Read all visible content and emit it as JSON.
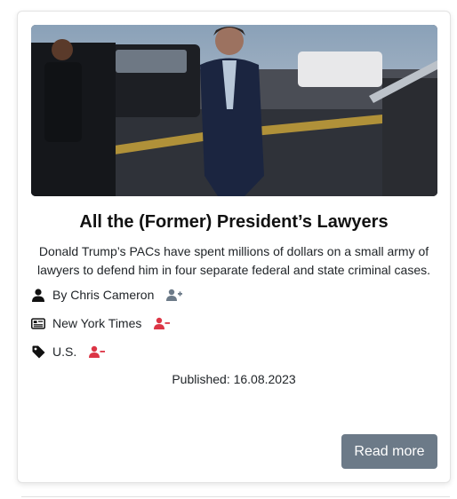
{
  "article": {
    "title": "All the (Former) President’s Lawyers",
    "description": "Donald Trump’s PACs have spent millions of dollars on a small army of lawyers to defend him in four separate federal and state criminal cases.",
    "author": "By Chris Cameron",
    "source": "New York Times",
    "category": "U.S.",
    "published": "Published: 16.08.2023",
    "read_more_label": "Read more"
  },
  "icons": {
    "author": "user-icon",
    "author_action": "user-plus-icon",
    "source": "newspaper-icon",
    "source_action": "user-minus-icon",
    "category": "tag-icon",
    "category_action": "user-minus-icon"
  },
  "colors": {
    "follow_icon": "#6c7a88",
    "unfollow_icon": "#dc3545",
    "button": "#6c7a88"
  }
}
